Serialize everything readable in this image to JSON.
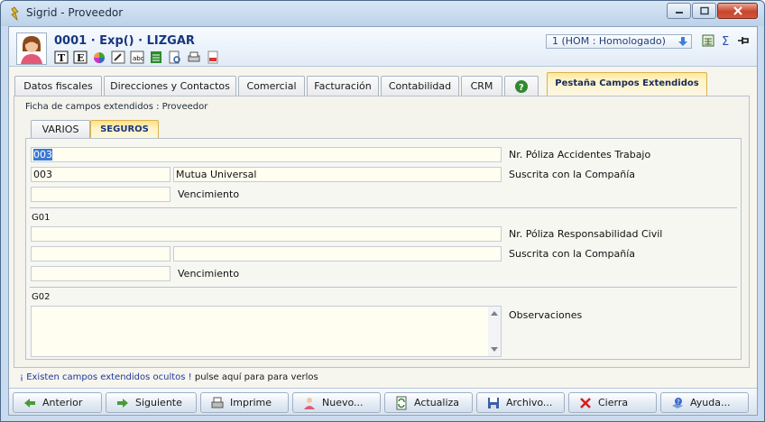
{
  "window": {
    "title": "Sigrid - Proveedor"
  },
  "header": {
    "record_title": "0001 · Exp() · LIZGAR",
    "homologation": "1 (HOM : Homologado)",
    "toolbar_icons": [
      "text-format-icon",
      "edit-icon",
      "color-wheel-icon",
      "brush-icon",
      "image-icon",
      "spreadsheet-icon",
      "document-search-icon",
      "print-icon",
      "pdf-icon"
    ],
    "right_icons": [
      "calculator-icon",
      "sigma-icon",
      "pin-icon"
    ]
  },
  "tabs": [
    {
      "label": "Datos fiscales"
    },
    {
      "label": "Direcciones y Contactos"
    },
    {
      "label": "Comercial"
    },
    {
      "label": "Facturación"
    },
    {
      "label": "Contabilidad"
    },
    {
      "label": "CRM"
    },
    {
      "label": "Pestaña Campos Extendidos",
      "active": true
    }
  ],
  "panel": {
    "ficha_label": "Ficha de campos extendidos : Proveedor",
    "subtabs": [
      {
        "label": "VARIOS"
      },
      {
        "label": "SEGUROS",
        "active": true
      }
    ]
  },
  "form": {
    "poliza_accidentes": {
      "value": "003",
      "label": "Nr. Póliza Accidentes Trabajo"
    },
    "compania_1": {
      "code": "003",
      "name": "Mutua Universal",
      "label": "Suscrita con la Compañía"
    },
    "vencimiento_1": {
      "value": "",
      "label": "Vencimiento"
    },
    "group_g01": "G01",
    "poliza_rc": {
      "value": "",
      "label": "Nr. Póliza Responsabilidad Civil"
    },
    "compania_2": {
      "code": "",
      "name": "",
      "label": "Suscrita con la Compañía"
    },
    "vencimiento_2": {
      "value": "",
      "label": "Vencimiento"
    },
    "group_g02": "G02",
    "observaciones": {
      "value": "",
      "label": "Observaciones"
    }
  },
  "hidden_fields_note": {
    "link": "¡ Existen campos extendidos ocultos !",
    "hint": "pulse aquí para para verlos"
  },
  "bottom_buttons": [
    {
      "label": "Anterior",
      "icon": "arrow-left-icon"
    },
    {
      "label": "Siguiente",
      "icon": "arrow-right-icon"
    },
    {
      "label": "Imprime",
      "icon": "printer-icon"
    },
    {
      "label": "Nuevo...",
      "icon": "new-user-icon"
    },
    {
      "label": "Actualiza",
      "icon": "refresh-icon"
    },
    {
      "label": "Archivo...",
      "icon": "save-icon"
    },
    {
      "label": "Cierra",
      "icon": "close-x-icon"
    },
    {
      "label": "Ayuda...",
      "icon": "help-icon"
    }
  ]
}
